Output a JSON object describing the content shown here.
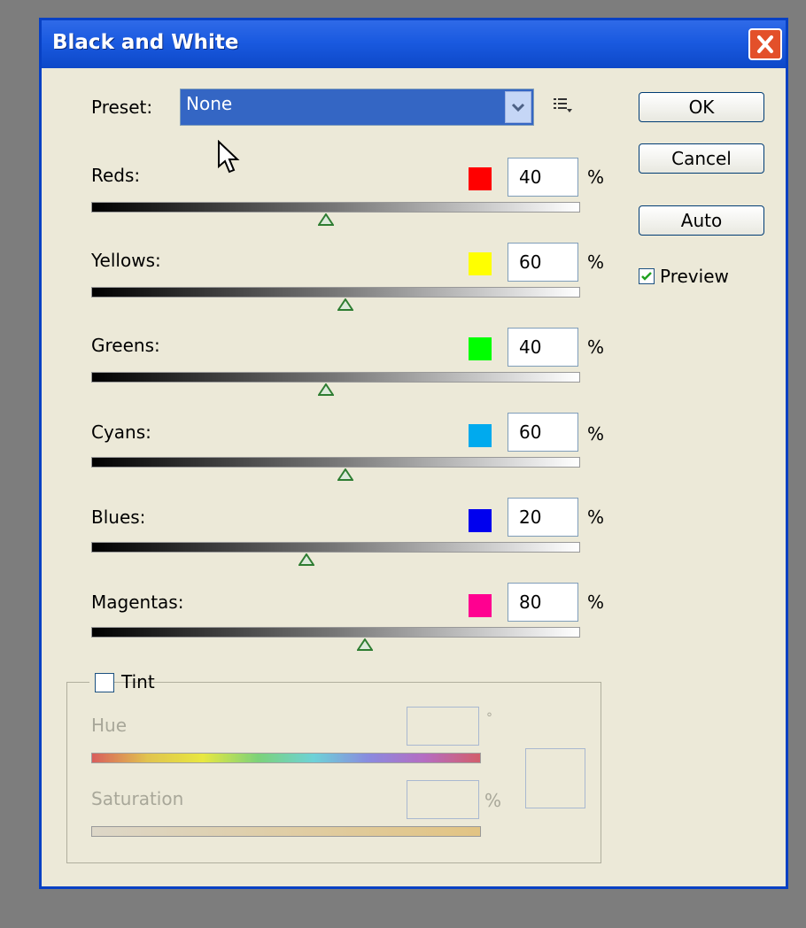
{
  "window": {
    "title": "Black and White"
  },
  "preset": {
    "label": "Preset:",
    "value": "None"
  },
  "buttons": {
    "ok": "OK",
    "cancel": "Cancel",
    "auto": "Auto"
  },
  "preview": {
    "label": "Preview",
    "checked": true
  },
  "channels": [
    {
      "label": "Reds:",
      "value": "40",
      "unit": "%",
      "color": "#ff0000",
      "slider_fraction": 0.48
    },
    {
      "label": "Yellows:",
      "value": "60",
      "unit": "%",
      "color": "#ffff00",
      "slider_fraction": 0.52
    },
    {
      "label": "Greens:",
      "value": "40",
      "unit": "%",
      "color": "#00ff00",
      "slider_fraction": 0.48
    },
    {
      "label": "Cyans:",
      "value": "60",
      "unit": "%",
      "color": "#00aaee",
      "slider_fraction": 0.52
    },
    {
      "label": "Blues:",
      "value": "20",
      "unit": "%",
      "color": "#0000ee",
      "slider_fraction": 0.44
    },
    {
      "label": "Magentas:",
      "value": "80",
      "unit": "%",
      "color": "#ff0090",
      "slider_fraction": 0.56
    }
  ],
  "tint": {
    "label": "Tint",
    "checked": false,
    "hue_label": "Hue",
    "hue_unit": "°",
    "saturation_label": "Saturation",
    "saturation_unit": "%"
  },
  "icons": {
    "close": "close-icon",
    "dropdown": "chevron-down-icon",
    "menu": "preset-options-icon",
    "check": "checkmark-icon",
    "cursor": "mouse-pointer-icon"
  },
  "colors": {
    "title_bar": "#1a5ae0",
    "dialog_bg": "#ece9d8",
    "selection": "#3466c4"
  }
}
